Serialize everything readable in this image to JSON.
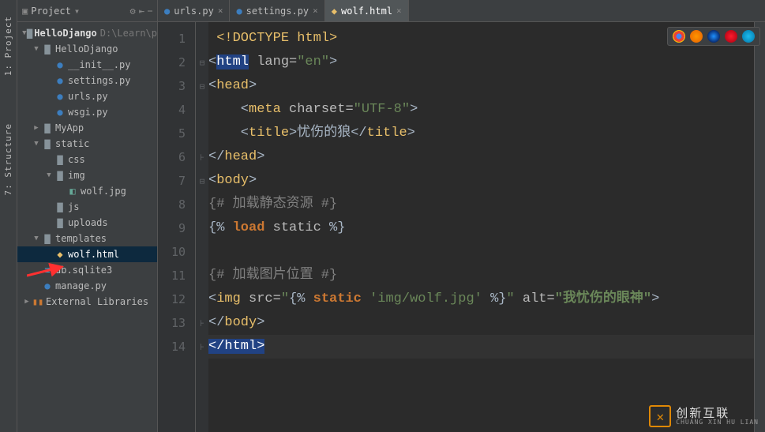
{
  "sidebars": {
    "project": "1: Project",
    "structure": "7: Structure"
  },
  "toolbar": {
    "title": "Project"
  },
  "tree": {
    "root": {
      "label": "HelloDjango",
      "path": "D:\\Learn\\p"
    },
    "pkg": {
      "label": "HelloDjango"
    },
    "files_pkg": [
      "__init__.py",
      "settings.py",
      "urls.py",
      "wsgi.py"
    ],
    "myapp": "MyApp",
    "static": "static",
    "css": "css",
    "img": "img",
    "wolfjpg": "wolf.jpg",
    "js": "js",
    "uploads": "uploads",
    "templates": "templates",
    "wolfhtml": "wolf.html",
    "dbsqlite": "db.sqlite3",
    "managepy": "manage.py",
    "extlib": "External Libraries"
  },
  "tabs": [
    {
      "label": "urls.py",
      "icon": "py",
      "active": false
    },
    {
      "label": "settings.py",
      "icon": "py",
      "active": false
    },
    {
      "label": "wolf.html",
      "icon": "html",
      "active": true
    }
  ],
  "code": {
    "l1": {
      "doctype": "<!DOCTYPE html>"
    },
    "l2": {
      "open": "<",
      "tag": "html",
      "sp": " ",
      "attr": "lang=",
      "val": "\"en\"",
      "close": ">"
    },
    "l3": {
      "open": "<",
      "tag": "head",
      "close": ">"
    },
    "l4": {
      "open": "    <",
      "tag": "meta",
      "sp": " ",
      "attr": "charset=",
      "val": "\"UTF-8\"",
      "close": ">"
    },
    "l5": {
      "open": "    <",
      "tag": "title",
      "close": ">",
      "text": "忧伤的狼",
      "copen": "</",
      "ctag": "title",
      "cclose": ">"
    },
    "l6": {
      "open": "</",
      "tag": "head",
      "close": ">"
    },
    "l7": {
      "open": "<",
      "tag": "body",
      "close": ">"
    },
    "l8": {
      "cm": "{# 加载静态资源 #}"
    },
    "l9": {
      "d1": "{% ",
      "kw": "load",
      "sp": " ",
      "id": "static",
      "d2": " %}"
    },
    "l11": {
      "cm": "{# 加载图片位置 #}"
    },
    "l12": {
      "open": "<",
      "tag": "img",
      "sp": " ",
      "attr1": "src=",
      "q1": "\"",
      "d1": "{% ",
      "kw": "static",
      "sp2": " ",
      "path": "'img/wolf.jpg'",
      "d2": " %}",
      "q2": "\"",
      "sp3": " ",
      "attr2": "alt=",
      "val2": "\"我忧伤的眼神\"",
      "close": ">"
    },
    "l13": {
      "open": "</",
      "tag": "body",
      "close": ">"
    },
    "l14": {
      "open": "</",
      "tag": "html",
      "close": ">"
    }
  },
  "watermark": {
    "cn": "创新互联",
    "en": "CHUANG XIN HU LIAN"
  },
  "chart_data": null
}
